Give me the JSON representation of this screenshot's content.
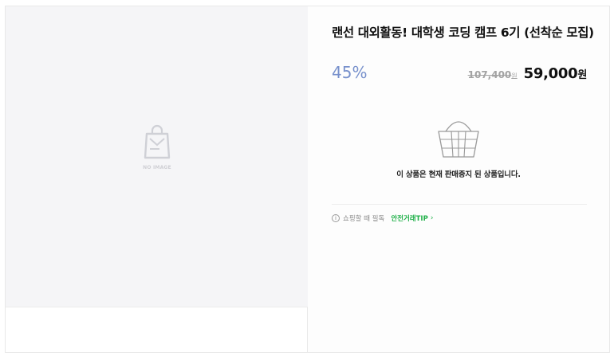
{
  "product": {
    "title": "랜선 대외활동! 대학생 코딩 캠프 6기 (선착순 모집)",
    "discount": "45%",
    "original_price": "107,400",
    "original_unit": "원",
    "sale_price": "59,000",
    "sale_unit": "원"
  },
  "image": {
    "placeholder_label": "NO IMAGE",
    "icon": "shopping-bag-icon"
  },
  "status": {
    "icon": "basket-icon",
    "message": "이 상품은 현재 판매중지 된 상품입니다."
  },
  "tip": {
    "icon": "info-icon",
    "icon_glyph": "i",
    "text": "쇼핑할 때 필독",
    "link_label": "안전거래TIP",
    "arrow": "›"
  },
  "colors": {
    "discount": "#7891cc",
    "tip_link": "#21b14a"
  }
}
